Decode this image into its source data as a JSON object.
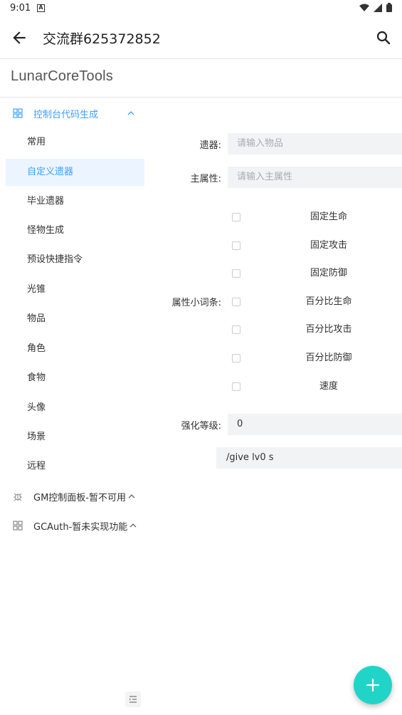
{
  "status": {
    "time": "9:01"
  },
  "appbar": {
    "title": "交流群625372852"
  },
  "brand": "LunarCoreTools",
  "menu": {
    "console": {
      "label": "控制台代码生成"
    },
    "items": [
      "常用",
      "自定义遗器",
      "毕业遗器",
      "怪物生成",
      "预设快捷指令",
      "光锥",
      "物品",
      "角色",
      "食物",
      "头像",
      "场景",
      "远程"
    ],
    "active_index": 1,
    "gm": {
      "label": "GM控制面板-暂不可用"
    },
    "gcauth": {
      "label": "GCAuth-暂未实现功能"
    }
  },
  "form": {
    "relic": {
      "label": "遗器:",
      "placeholder": "请输入物品"
    },
    "main_attr": {
      "label": "主属性:",
      "placeholder": "请输入主属性"
    },
    "sub_attr": {
      "label": "属性小词条:",
      "options": [
        "固定生命",
        "固定攻击",
        "固定防御",
        "百分比生命",
        "百分比攻击",
        "百分比防御",
        "速度"
      ]
    },
    "level": {
      "label": "强化等级:",
      "value": "0"
    },
    "command": "/give  lv0 s"
  },
  "colors": {
    "accent": "#409eff",
    "fab": "#21d4c8"
  }
}
